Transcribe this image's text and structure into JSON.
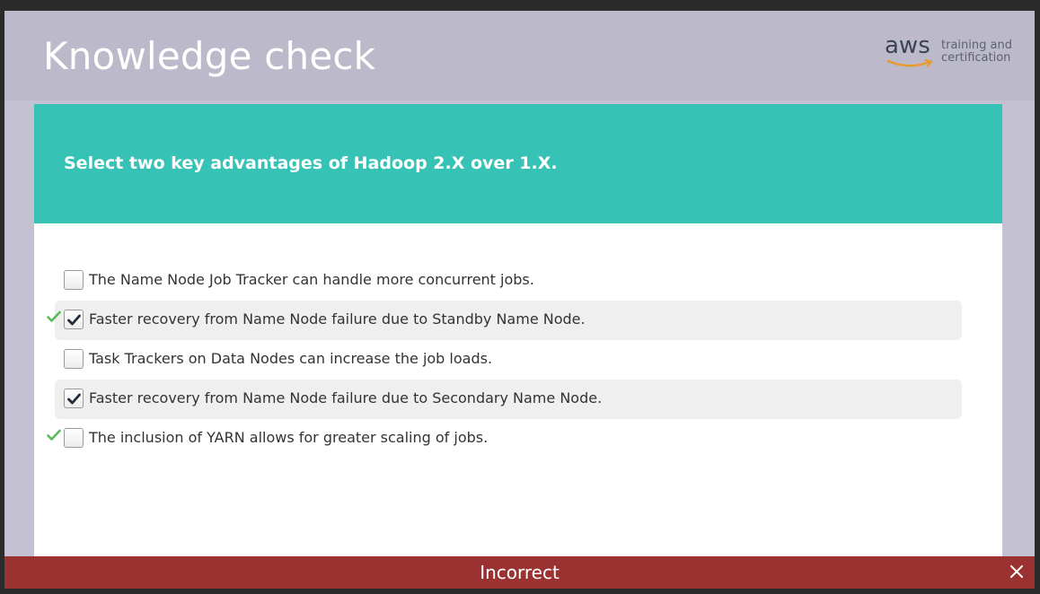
{
  "header": {
    "title": "Knowledge check",
    "logo": {
      "wordmark": "aws",
      "line1": "training and",
      "line2": "certification"
    }
  },
  "question": {
    "text": "Select two key advantages of Hadoop 2.X over 1.X."
  },
  "options": [
    {
      "label": "The Name Node Job Tracker can handle more concurrent jobs.",
      "selected": false,
      "correct": false
    },
    {
      "label": "Faster recovery from Name Node failure due to Standby Name Node.",
      "selected": true,
      "correct": true
    },
    {
      "label": "Task Trackers on Data Nodes can increase the job loads.",
      "selected": false,
      "correct": false
    },
    {
      "label": "Faster recovery from Name Node failure due to Secondary Name Node.",
      "selected": true,
      "correct": false
    },
    {
      "label": "The inclusion of YARN allows for greater scaling of jobs.",
      "selected": false,
      "correct": true
    }
  ],
  "feedback": {
    "text": "Incorrect"
  },
  "icons": {
    "checkbox_tick": "checkmark-icon",
    "correct_indicator": "correct-checkmark-icon",
    "close": "close-icon"
  },
  "colors": {
    "question_band": "#36c3b6",
    "feedback_bar": "#9a3232",
    "correct_mark": "#5cb85c"
  }
}
